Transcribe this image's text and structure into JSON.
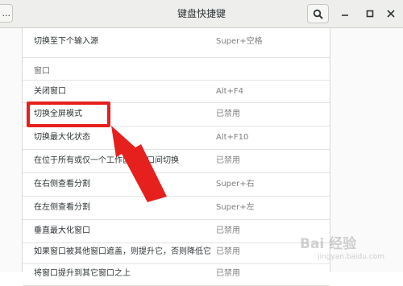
{
  "header": {
    "back_label": "...",
    "title": "键盘快捷键",
    "search_icon": "search-icon",
    "minimize_icon": "minimize-icon",
    "maximize_icon": "maximize-icon",
    "close_icon": "close-icon"
  },
  "shortcuts": {
    "top_row": {
      "name": "切换至下个输入源",
      "key": "Super+空格"
    },
    "section_window": "窗口",
    "rows": [
      {
        "name": "关闭窗口",
        "key": "Alt+F4"
      },
      {
        "name": "切换全屏模式",
        "key": "已禁用"
      },
      {
        "name": "切换最大化状态",
        "key": "Alt+F10"
      },
      {
        "name": "在位于所有或仅一个工作区的窗口间切换",
        "key": "已禁用"
      },
      {
        "name": "在右侧查看分割",
        "key": "Super+右"
      },
      {
        "name": "在左侧查看分割",
        "key": "Super+左"
      },
      {
        "name": "垂直最大化窗口",
        "key": "已禁用"
      },
      {
        "name": "如果窗口被其他窗口遮盖，则提升它，否则降低它",
        "key": "已禁用"
      },
      {
        "name": "将窗口提升到其它窗口之上",
        "key": "已禁用"
      }
    ]
  },
  "annotation": {
    "highlight_color": "#e5201d"
  },
  "watermark": {
    "logo": "Bai 经验",
    "sub": "jingyan.baidu.com"
  }
}
